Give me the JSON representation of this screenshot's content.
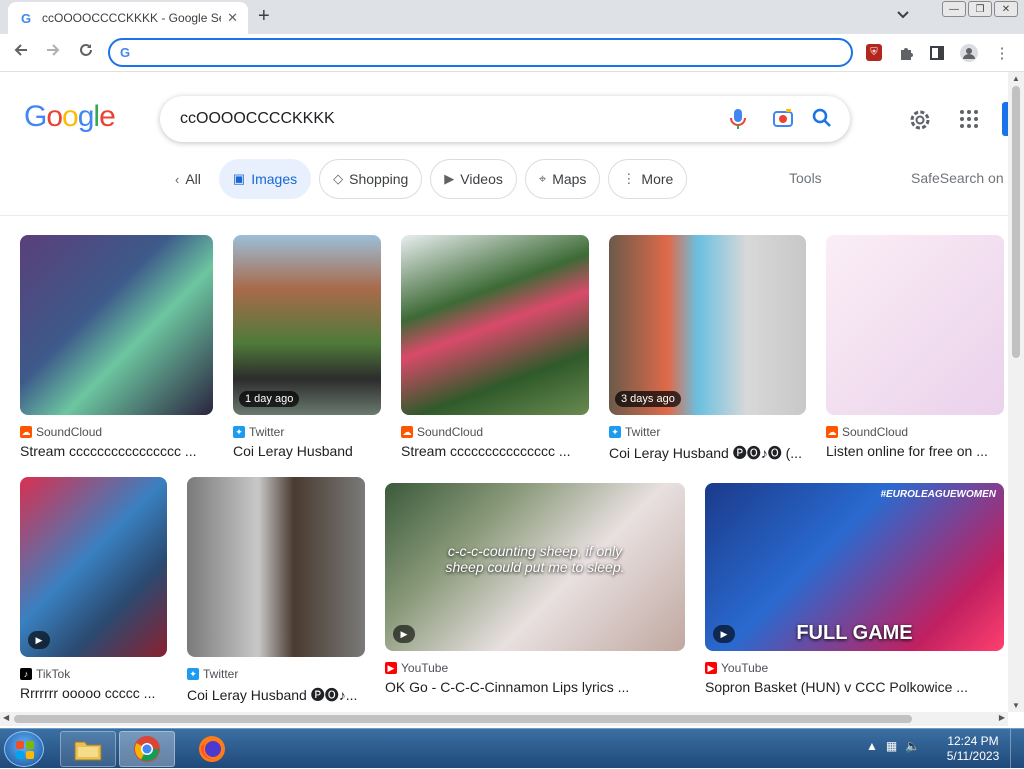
{
  "browser": {
    "tab_title": "ccOOOOCCCCKKKK - Google Sea",
    "tab_favicon": "G",
    "tab_close": "✕",
    "new_tab": "+",
    "tab_dropdown": "⌄",
    "win_minimize": "—",
    "win_restore": "❐",
    "win_close": "✕",
    "omnibox_value": "",
    "omnibox_icon": "G",
    "extension_badge": "4"
  },
  "google": {
    "logo_letters": [
      {
        "ch": "G",
        "color": "#4285f4"
      },
      {
        "ch": "o",
        "color": "#ea4335"
      },
      {
        "ch": "o",
        "color": "#fbbc05"
      },
      {
        "ch": "g",
        "color": "#4285f4"
      },
      {
        "ch": "l",
        "color": "#34a853"
      },
      {
        "ch": "e",
        "color": "#ea4335"
      }
    ],
    "query": "ccOOOOCCCCKKKK",
    "chips": [
      {
        "label": "All",
        "icon": "‹",
        "icon_name": "chevron-left-icon",
        "active": false,
        "plain": true
      },
      {
        "label": "Images",
        "icon": "▣",
        "icon_name": "image-icon",
        "active": true,
        "plain": false
      },
      {
        "label": "Shopping",
        "icon": "◇",
        "icon_name": "tag-icon",
        "active": false,
        "plain": false
      },
      {
        "label": "Videos",
        "icon": "▶",
        "icon_name": "video-icon",
        "active": false,
        "plain": false
      },
      {
        "label": "Maps",
        "icon": "⌖",
        "icon_name": "map-pin-icon",
        "active": false,
        "plain": false
      },
      {
        "label": "More",
        "icon": "⋮",
        "icon_name": "more-vert-icon",
        "active": false,
        "plain": false
      }
    ],
    "tools": "Tools",
    "safesearch": "SafeSearch on"
  },
  "results": [
    {
      "source": "SoundCloud",
      "source_icon": "soundcloud",
      "caption": "Stream cccccccccccccccc ...",
      "badge": "",
      "video": false,
      "bg": "linear-gradient(135deg,#5a3f7a,#3d5a8a 40%,#6cc6a0 60%,#2b2440)"
    },
    {
      "source": "Twitter",
      "source_icon": "twitter",
      "caption": "Coi Leray Husband",
      "badge": "1 day ago",
      "video": false,
      "bg": "linear-gradient(180deg,#9bbfd8 0%,#a86a4a 30%,#4f7a3a 60%,#2c2c2c 80%,#6a7a70)"
    },
    {
      "source": "SoundCloud",
      "source_icon": "soundcloud",
      "caption": "Stream ccccccccccccccc ...",
      "badge": "",
      "video": false,
      "bg": "linear-gradient(160deg,#e8eef0 0%,#3d6a35 35%,#d94a6a 50%,#2f5a2a 75%,#6a8a50)"
    },
    {
      "source": "Twitter",
      "source_icon": "twitter",
      "caption": "Coi Leray Husband 🅟🅞♪🅞 (...",
      "badge": "3 days ago",
      "video": false,
      "bg": "linear-gradient(90deg,#6b5a4a 0%,#e06a4a 30%,#6ac0e0 45%,#d8d8d8 70%,#c8c8c8)"
    },
    {
      "source": "SoundCloud",
      "source_icon": "soundcloud",
      "caption": "Listen online for free on ...",
      "badge": "",
      "video": false,
      "bg": "linear-gradient(135deg,#fbeef6,#f2dff0 50%,#ead2ec)"
    },
    {
      "source": "TikTok",
      "source_icon": "tiktok",
      "caption": "Rrrrrrr ooooo ccccc ...",
      "badge": "",
      "video": true,
      "bg": "linear-gradient(135deg,#d83050,#3a80c0 45%,#2a4a70 70%,#8a2030)"
    },
    {
      "source": "Twitter",
      "source_icon": "twitter",
      "caption": "Coi Leray Husband 🅟🅞♪...",
      "badge": "",
      "video": false,
      "bg": "linear-gradient(90deg,#7a7a7a,#c8c8c8 40%,#4a3a30 60%,#7a7a7a)"
    },
    {
      "source": "YouTube",
      "source_icon": "youtube",
      "caption": "OK Go - C-C-C-Cinnamon Lips lyrics ...",
      "badge": "",
      "video": true,
      "bg": "linear-gradient(135deg,#3a5a3a,#8a9a7a 30%,#e8e0e0 60%,#c0a8a0)",
      "overlay": "c-c-c-counting sheep, if only sheep could put me to sleep."
    },
    {
      "source": "YouTube",
      "source_icon": "youtube",
      "caption": "Sopron Basket (HUN) v CCC Polkowice ...",
      "badge": "",
      "video": true,
      "bg": "linear-gradient(135deg,#1a3a8a,#2a6ad0 40%,#c02060 80%,#ff4070)",
      "overlay": "FULL GAME",
      "overlay_top": "#EUROLEAGUEWOMEN"
    }
  ],
  "taskbar": {
    "time": "12:24 PM",
    "date": "5/11/2023"
  },
  "colors": {
    "accent": "#1a73e8",
    "taskbar": "#2a5a8a"
  }
}
